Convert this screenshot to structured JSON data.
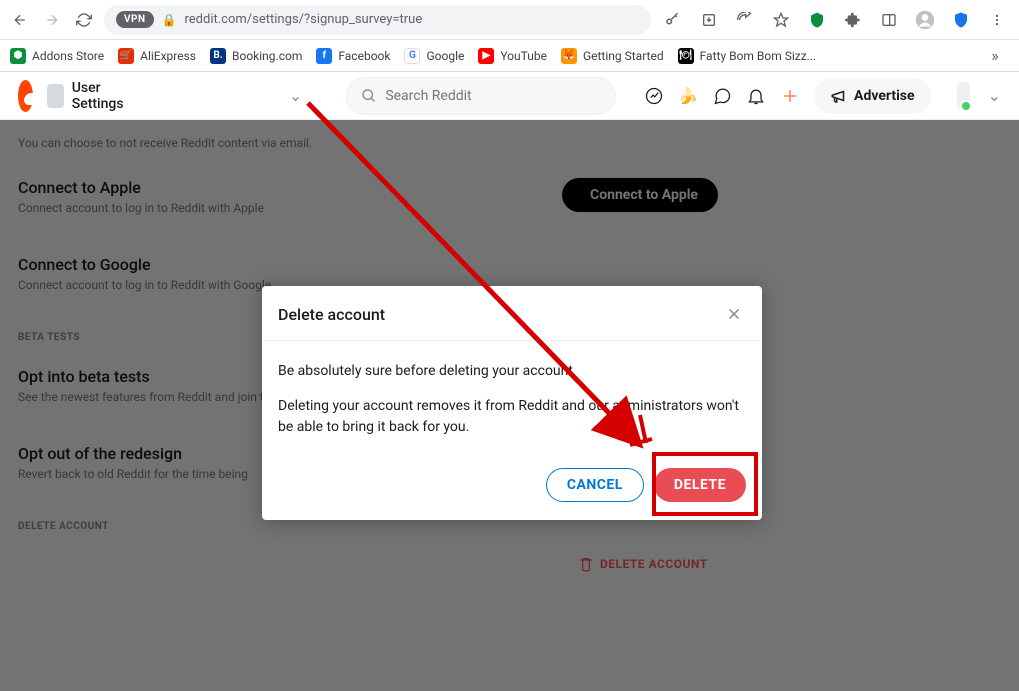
{
  "browser": {
    "url": "reddit.com/settings/?signup_survey=true",
    "vpn_label": "VPN"
  },
  "bookmarks": [
    {
      "label": "Addons Store",
      "color": "#0a8f3c"
    },
    {
      "label": "AliExpress",
      "color": "#e62e04"
    },
    {
      "label": "Booking.com",
      "color": "#003580"
    },
    {
      "label": "Facebook",
      "color": "#1877f2"
    },
    {
      "label": "Google",
      "color": "#fff"
    },
    {
      "label": "YouTube",
      "color": "#ff0000"
    },
    {
      "label": "Getting Started",
      "color": "#ff9500"
    },
    {
      "label": "Fatty Bom Bom Sizz...",
      "color": "#000"
    }
  ],
  "header": {
    "page_label": "User Settings",
    "search_placeholder": "Search Reddit",
    "advertise": "Advertise"
  },
  "settings": {
    "prev_desc": "You can choose to not receive Reddit content via email.",
    "apple": {
      "title": "Connect to Apple",
      "desc": "Connect account to log in to Reddit with Apple",
      "btn": "Connect to Apple"
    },
    "google": {
      "title": "Connect to Google",
      "desc": "Connect account to log in to Reddit with Google"
    },
    "beta_head": "BETA TESTS",
    "optin": {
      "title": "Opt into beta tests",
      "desc": "See the newest features from Reddit and join the"
    },
    "optout": {
      "title": "Opt out of the redesign",
      "desc": "Revert back to old Reddit for the time being"
    },
    "delete_head": "DELETE ACCOUNT",
    "delete_link": "DELETE ACCOUNT"
  },
  "modal": {
    "title": "Delete account",
    "line1": "Be absolutely sure before deleting your account",
    "line2": "Deleting your account removes it from Reddit and our administrators won't be able to bring it back for you.",
    "cancel": "CANCEL",
    "delete": "DELETE"
  }
}
